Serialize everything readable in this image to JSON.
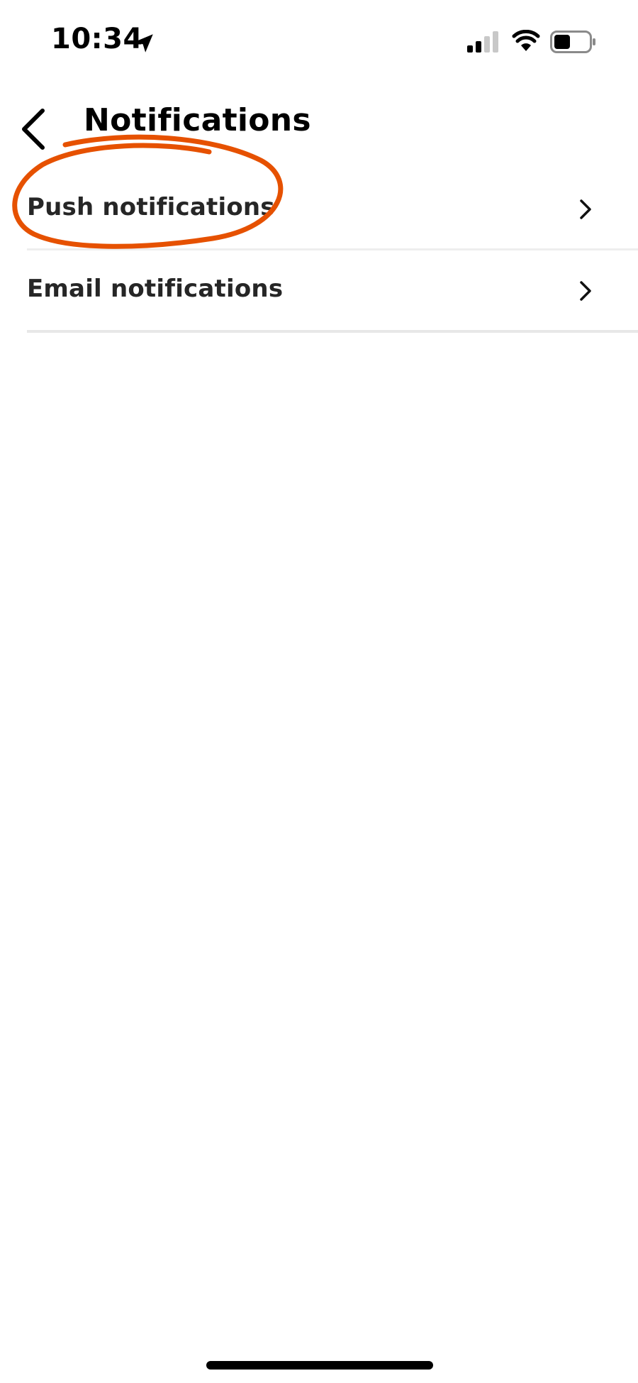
{
  "status_bar": {
    "time": "10:34",
    "icons": [
      "location-arrow-icon",
      "cellular-signal-icon",
      "wifi-icon",
      "battery-icon"
    ]
  },
  "header": {
    "title": "Notifications",
    "back_icon": "chevron-left-icon"
  },
  "settings_list": {
    "items": [
      {
        "label": "Push notifications",
        "icon": "chevron-right-icon"
      },
      {
        "label": "Email notifications",
        "icon": "chevron-right-icon"
      }
    ]
  },
  "colors": {
    "annotation": "#e65100",
    "text": "#262626",
    "divider": "#eeeeee"
  }
}
